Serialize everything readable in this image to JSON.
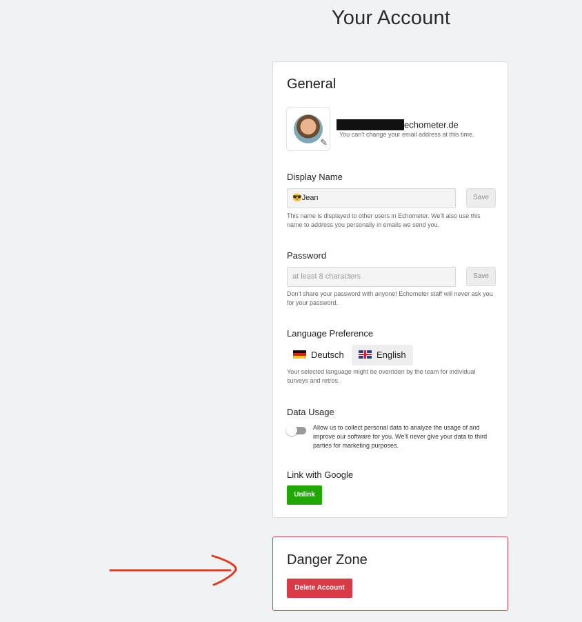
{
  "page": {
    "title": "Your Account"
  },
  "general": {
    "heading": "General",
    "email": {
      "domain": "echometer.de",
      "note": "You can't change your email address at this time."
    },
    "display_name": {
      "label": "Display Name",
      "value": "😎Jean",
      "save_label": "Save",
      "help": "This name is displayed to other users in Echometer. We'll also use this name to address you personally in emails we send you."
    },
    "password": {
      "label": "Password",
      "placeholder": "at least 8 characters",
      "save_label": "Save",
      "help": "Don't share your password with anyone! Echometer staff will never ask you for your password."
    },
    "language": {
      "label": "Language Preference",
      "options": [
        {
          "label": "Deutsch",
          "flag": "germany-flag-icon",
          "selected": false
        },
        {
          "label": "English",
          "flag": "uk-flag-icon",
          "selected": true
        }
      ],
      "help": "Your selected language might be overriden by the team for individual surveys and retros."
    },
    "data_usage": {
      "label": "Data Usage",
      "enabled": false,
      "text": "Allow us to collect personal data to analyze the usage of and improve our software for you. We'll never give your data to third parties for marketing purposes."
    },
    "google": {
      "label": "Link with Google",
      "button_label": "Unlink",
      "button_color": "#21a806"
    }
  },
  "danger": {
    "heading": "Danger Zone",
    "button_label": "Delete Account",
    "button_color": "#da3a46",
    "border_color": "#d9414f"
  },
  "annotation": {
    "arrow_color": "#e23a1e"
  }
}
